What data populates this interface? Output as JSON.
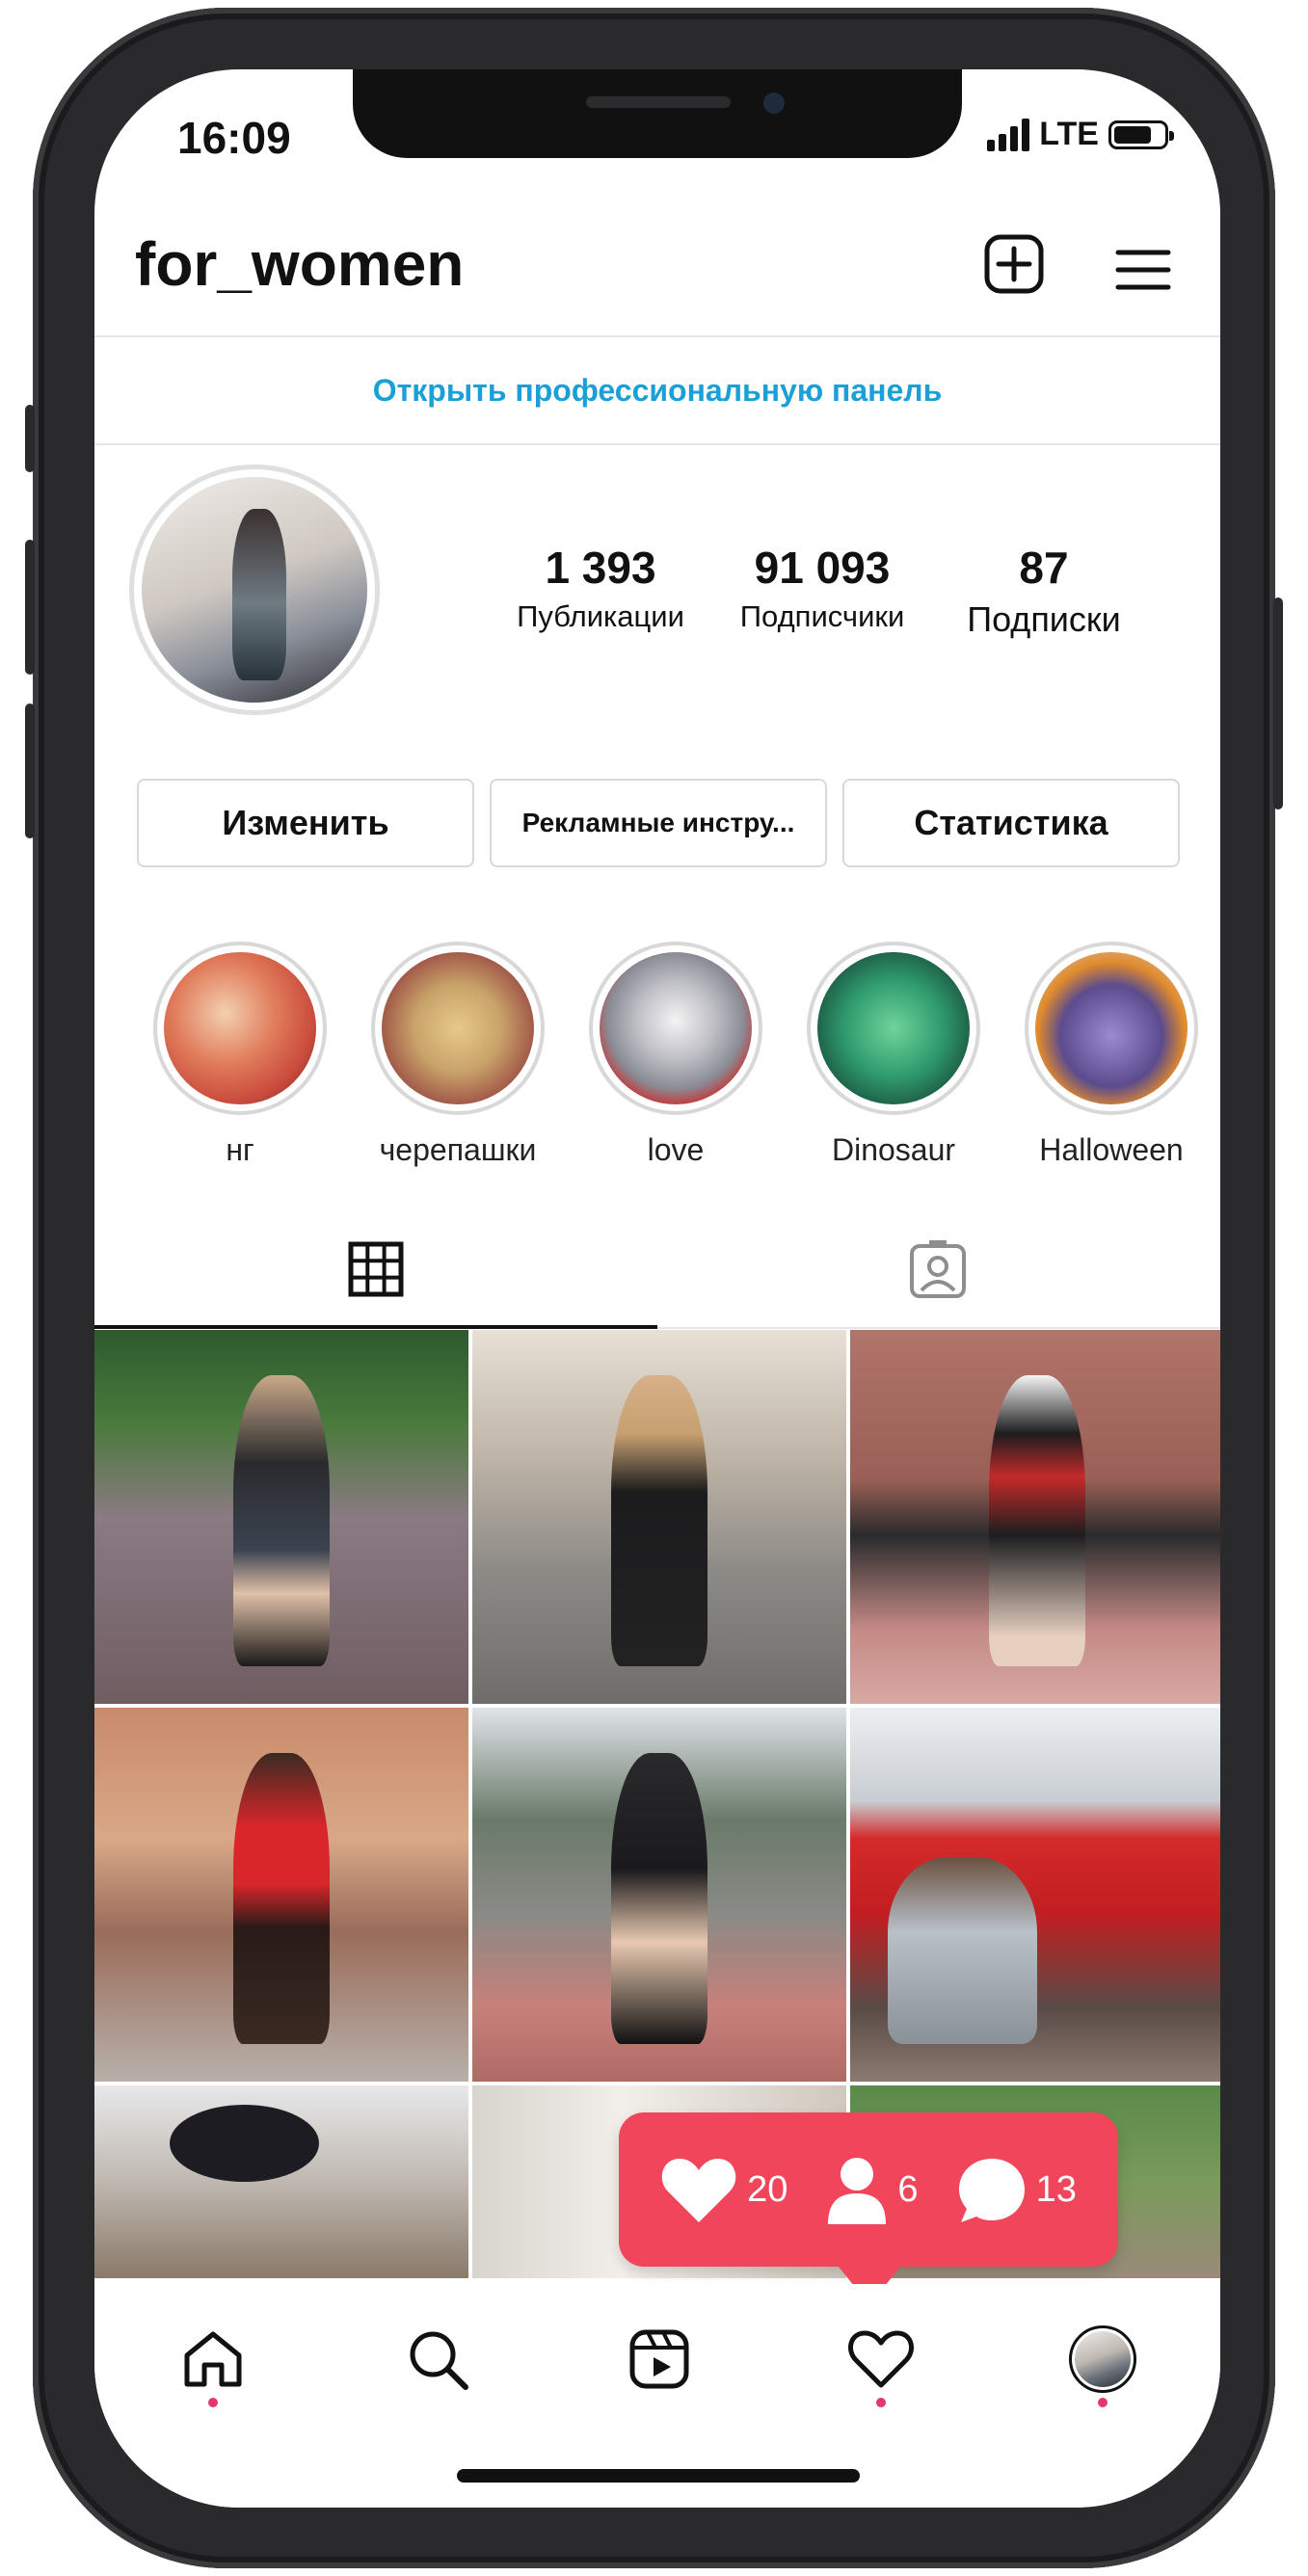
{
  "status_bar": {
    "time": "16:09",
    "network": "LTE"
  },
  "profile": {
    "username": "for_women",
    "pro_panel_label": "Открыть профессиональную панель",
    "stats": [
      {
        "value": "1 393",
        "label": "Публикации"
      },
      {
        "value": "91 093",
        "label": "Подписчики"
      },
      {
        "value": "87",
        "label": "Подписки"
      }
    ],
    "buttons": {
      "edit": "Изменить",
      "ads": "Рекламные инстру...",
      "insights": "Статистика"
    }
  },
  "highlights": [
    {
      "label": "нг",
      "color": "#c94a3c"
    },
    {
      "label": "черепашки",
      "color": "#c9a36a"
    },
    {
      "label": "love",
      "color": "#8a8c95"
    },
    {
      "label": "Dinosaur",
      "color": "#2f9b6e"
    },
    {
      "label": "Halloween",
      "color": "#5c4c8e"
    }
  ],
  "notification": {
    "likes": "20",
    "followers": "6",
    "comments": "13"
  },
  "colors": {
    "accent": "#f0455a",
    "link": "#1aa0d6",
    "nav_dot": "#e2386f"
  },
  "icons": {
    "top": [
      "plus-square-icon",
      "hamburger-menu-icon"
    ],
    "tabs": [
      "grid-icon",
      "tagged-person-icon"
    ],
    "nav": [
      "home-icon",
      "search-icon",
      "reels-icon",
      "heart-icon",
      "profile-avatar"
    ]
  }
}
